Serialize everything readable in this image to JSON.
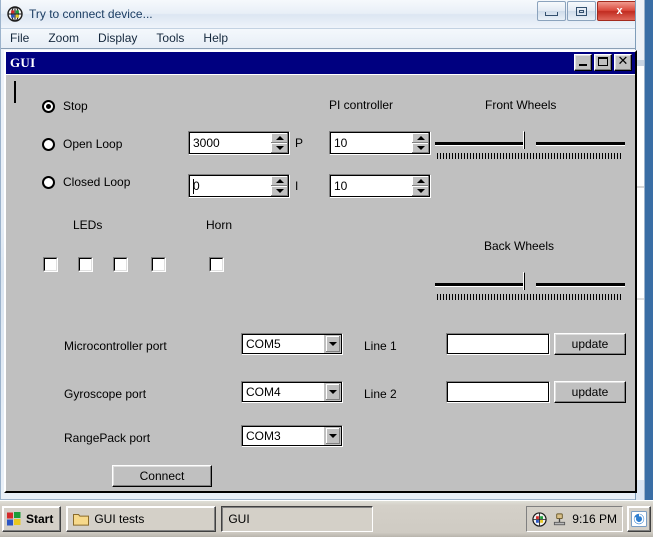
{
  "outer_window": {
    "title": "Try to connect device...",
    "app_icon": "globe-icon",
    "buttons": {
      "minimize": "minimize-icon",
      "restore": "restore-icon",
      "close": "x"
    }
  },
  "menubar": {
    "items": [
      {
        "label": "File"
      },
      {
        "label": "Zoom"
      },
      {
        "label": "Display"
      },
      {
        "label": "Tools"
      },
      {
        "label": "Help"
      }
    ]
  },
  "inner_window": {
    "title": "GUI",
    "buttons": {
      "minimize": "minimize-icon",
      "maximize": "maximize-icon",
      "close": "✕"
    }
  },
  "controls": {
    "mode_radios": [
      {
        "label": "Stop",
        "selected": true
      },
      {
        "label": "Open Loop",
        "selected": false
      },
      {
        "label": "Closed Loop",
        "selected": false
      }
    ],
    "gain_spinners": [
      {
        "value": "3000",
        "suffix_label": "P"
      },
      {
        "value": "0",
        "suffix_label": "I"
      }
    ],
    "pi_controller": {
      "title": "PI controller",
      "spinners": [
        {
          "value": "10"
        },
        {
          "value": "10"
        }
      ]
    },
    "front_wheels": {
      "title": "Front Wheels",
      "position_percent": 50
    },
    "back_wheels": {
      "title": "Back Wheels",
      "position_percent": 50
    },
    "leds": {
      "title": "LEDs",
      "checkboxes": [
        {
          "checked": false
        },
        {
          "checked": false
        },
        {
          "checked": false
        },
        {
          "checked": false
        }
      ]
    },
    "horn": {
      "title": "Horn",
      "checkbox": {
        "checked": false
      }
    },
    "ports": [
      {
        "label": "Microcontroller port",
        "value": "COM5"
      },
      {
        "label": "Gyroscope port",
        "value": "COM4"
      },
      {
        "label": "RangePack port",
        "value": "COM3"
      }
    ],
    "lines": [
      {
        "label": "Line 1",
        "value": "",
        "button": "update"
      },
      {
        "label": "Line 2",
        "value": "",
        "button": "update"
      }
    ],
    "connect_button": "Connect"
  },
  "taskbar": {
    "start_label": "Start",
    "tasks": [
      {
        "label": "GUI tests",
        "icon": "folder-icon",
        "active": false
      },
      {
        "label": "GUI",
        "icon": "",
        "active": true
      }
    ],
    "tray": {
      "icons": [
        "globe-icon",
        "device-icon"
      ],
      "clock": "9:16 PM",
      "right_icon": "refresh-icon"
    }
  },
  "colors": {
    "classic_face": "#c0c0c0",
    "title_navy": "#000080",
    "close_red": "#c12b20"
  }
}
